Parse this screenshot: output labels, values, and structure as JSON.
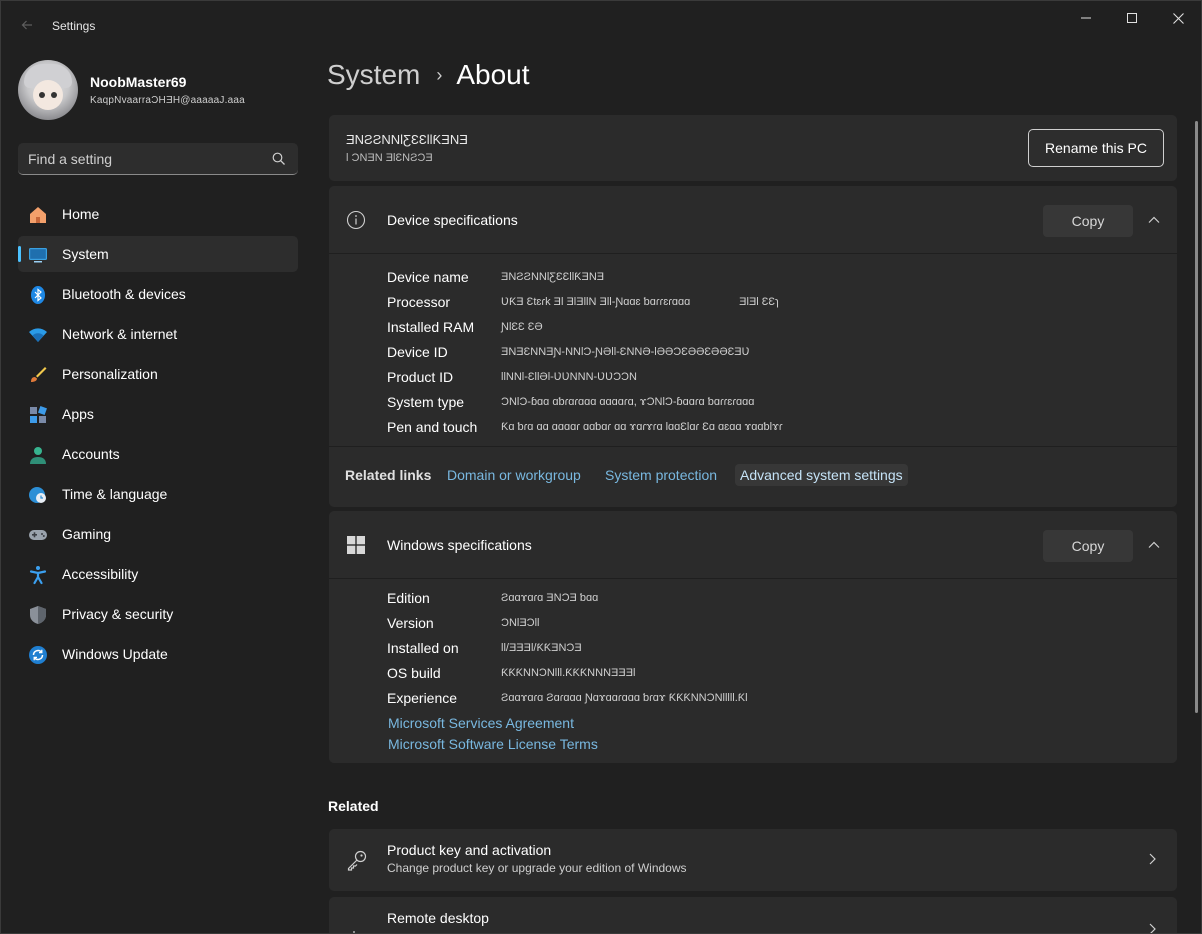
{
  "window": {
    "app_title": "Settings",
    "back_icon": "back-arrow-icon",
    "controls": [
      "minimize-icon",
      "maximize-icon",
      "close-icon"
    ]
  },
  "profile": {
    "name": "NoobMaster69",
    "email": "KaqpNvaarraƆHƎH@aaaaaJ.aaa"
  },
  "search": {
    "placeholder": "Find a setting",
    "value": ""
  },
  "sidebar": {
    "items": [
      {
        "label": "Home",
        "icon": "home-icon",
        "active": false
      },
      {
        "label": "System",
        "icon": "system-monitor-icon",
        "active": true
      },
      {
        "label": "Bluetooth & devices",
        "icon": "bluetooth-icon",
        "active": false
      },
      {
        "label": "Network & internet",
        "icon": "wifi-icon",
        "active": false
      },
      {
        "label": "Personalization",
        "icon": "paintbrush-icon",
        "active": false
      },
      {
        "label": "Apps",
        "icon": "apps-icon",
        "active": false
      },
      {
        "label": "Accounts",
        "icon": "person-icon",
        "active": false
      },
      {
        "label": "Time & language",
        "icon": "globe-clock-icon",
        "active": false
      },
      {
        "label": "Gaming",
        "icon": "gamepad-icon",
        "active": false
      },
      {
        "label": "Accessibility",
        "icon": "accessibility-icon",
        "active": false
      },
      {
        "label": "Privacy & security",
        "icon": "shield-icon",
        "active": false
      },
      {
        "label": "Windows Update",
        "icon": "update-icon",
        "active": false
      }
    ]
  },
  "breadcrumb": {
    "parent": "System",
    "separator": "›",
    "current": "About"
  },
  "pc": {
    "name": "ƎNƧƧNNƖƸƐƐƖƖƘƎNƎ",
    "subtitle": "Ɩ ƆNƎN ƎƖƐNƧƆƎ",
    "rename_label": "Rename this PC"
  },
  "device_specs": {
    "title": "Device specifications",
    "copy_label": "Copy",
    "rows": [
      {
        "label": "Device name",
        "value": "ƎNƧƧNNƖƸƐƐƖƖƘƎNƎ"
      },
      {
        "label": "Processor",
        "value": "ƲƘƎ Ɛtɛɾk ƎƖ ƎƖƎƖƖN ƎƖƖ-Ɲɑɑɛ ƅɑɾɾɛɾɑɑɑ                ƎƖƎƖ ƐƐɿ"
      },
      {
        "label": "Installed RAM",
        "value": "ƝƖƐƐ ƐƏ"
      },
      {
        "label": "Device ID",
        "value": "ƎNƎƐNNƎƝ-NNƖƆ-ƝƏƖƖ-ƐNNƏ-ƖƏƏƆƐƏƏƐƏƏƐƎƲ"
      },
      {
        "label": "Product ID",
        "value": "ƖƖNNƖ-ƐƖƖƏƖ-ƲƲNNN-ƲƲƆƆN"
      },
      {
        "label": "System type",
        "value": "ƆNƖƆ-ɓɑɑ ɑƅɾɑɾɑɑɑ ɑɑɑɑɾɑ, ɤƆNƖƆ-ɓɑɑɾɑ ƅɑɾɾɛɾɑɑɑ"
      },
      {
        "label": "Pen and touch",
        "value": "Ƙɑ ƅɾɑ ɑɑ ɑɑɑɑɾ ɑɑƅɑɾ ɑɑ ɤɑɾɤɾɑ ƖɑɑƐƖɑɾ Ɛɑ ɑɛɑɑ ɤɑɑƅƖɤɾ"
      }
    ]
  },
  "related_links": {
    "label": "Related links",
    "links": [
      "Domain or workgroup",
      "System protection",
      "Advanced system settings"
    ]
  },
  "windows_specs": {
    "title": "Windows specifications",
    "copy_label": "Copy",
    "rows": [
      {
        "label": "Edition",
        "value": "Ƨɑɑɤɑɾɑ ƎNƆƎ ƅɑɑ"
      },
      {
        "label": "Version",
        "value": "ƆNƖƎƆƖƖ"
      },
      {
        "label": "Installed on",
        "value": "ƖƖ/ƎƎƎƖ/ƘƘƎNƆƎ"
      },
      {
        "label": "OS build",
        "value": "ƘƘƘNNƆNƖƖƖ.ƘƘƘNNNƎƎƎƖ"
      },
      {
        "label": "Experience",
        "value": "Ƨɑɑɤɑɾɑ Ƨɑɾɑɑɑ Ɲɑɤɑɑɾɑɑɑ ƅɾɑɤ ƘƘƘNNƆNƖƖƖƖƖ.ƘƖ"
      }
    ],
    "links": [
      "Microsoft Services Agreement",
      "Microsoft Software License Terms"
    ]
  },
  "related": {
    "title": "Related",
    "items": [
      {
        "title": "Product key and activation",
        "subtitle": "Change product key or upgrade your edition of Windows",
        "icon": "key-icon"
      },
      {
        "title": "Remote desktop",
        "subtitle": "",
        "icon": "remote-desktop-icon"
      }
    ]
  },
  "colors": {
    "background": "#202020",
    "card": "#2b2b2b",
    "accent": "#4cc2ff",
    "link": "#79b8e0"
  }
}
